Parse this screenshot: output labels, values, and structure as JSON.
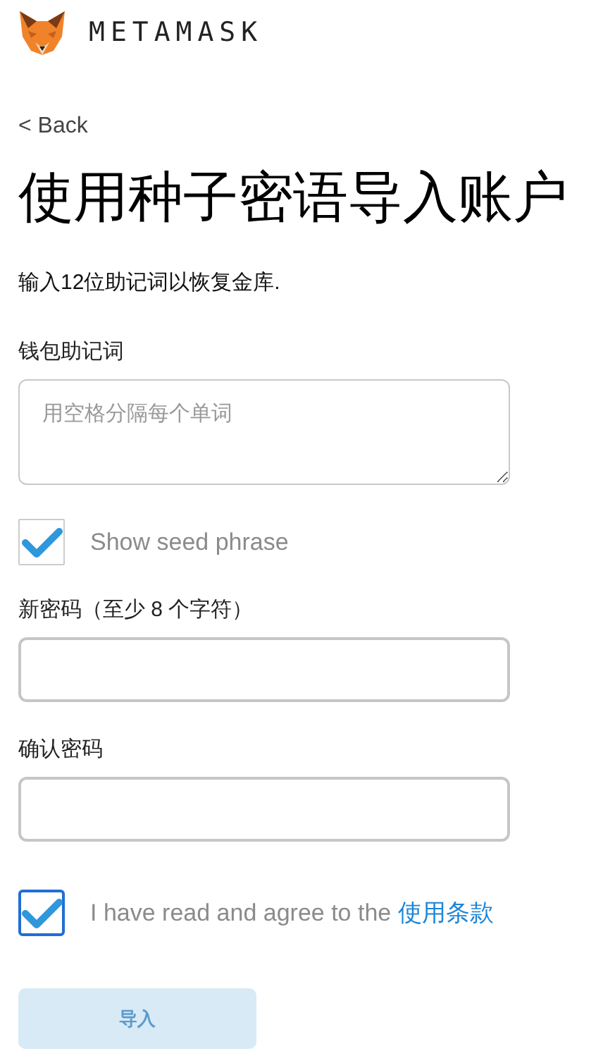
{
  "header": {
    "brand": "METAMASK"
  },
  "back_link": "< Back",
  "title": "使用种子密语导入账户",
  "subtitle": "输入12位助记词以恢复金库.",
  "seed_field": {
    "label": "钱包助记词",
    "placeholder": "用空格分隔每个单词"
  },
  "show_seed": {
    "label": "Show seed phrase",
    "checked": true
  },
  "password_field": {
    "label": "新密码（至少 8 个字符）"
  },
  "confirm_field": {
    "label": "确认密码"
  },
  "terms": {
    "text": "I have read and agree to the ",
    "link": "使用条款",
    "checked": true,
    "focused": true
  },
  "import_button": {
    "label": "导入",
    "disabled": true
  }
}
